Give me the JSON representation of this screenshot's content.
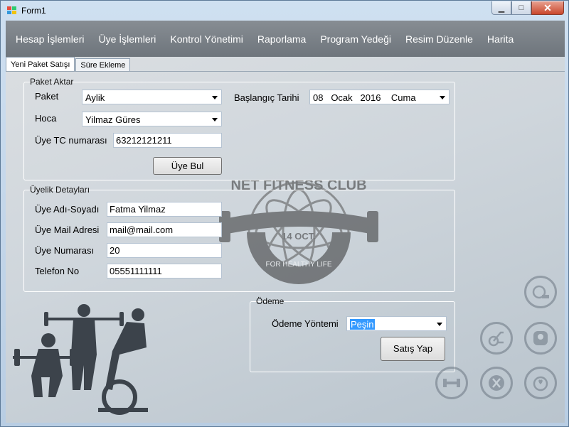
{
  "window": {
    "title": "Form1"
  },
  "menu": [
    "Hesap İşlemleri",
    "Üye İşlemleri",
    "Kontrol Yönetimi",
    "Raporlama",
    "Program Yedeği",
    "Resim Düzenle",
    "Harita"
  ],
  "tabs": [
    "Yeni Paket Satışı",
    "Süre Ekleme"
  ],
  "paket": {
    "group_label": "Paket Aktar",
    "paket_label": "Paket",
    "paket_value": "Aylik",
    "hoca_label": "Hoca",
    "hoca_value": "Yilmaz Güres",
    "tc_label": "Üye TC numarası",
    "tc_value": "63212121211",
    "start_label": "Başlangıç Tarihi",
    "date_day": "08",
    "date_month": "Ocak",
    "date_year": "2016",
    "date_weekday": "Cuma",
    "find_button": "Üye Bul"
  },
  "uyelik": {
    "group_label": "Üyelik Detayları",
    "name_label": "Üye Adı-Soyadı",
    "name_value": "Fatma Yilmaz",
    "mail_label": "Üye Mail Adresi",
    "mail_value": "mail@mail.com",
    "number_label": "Üye Numarası",
    "number_value": "20",
    "phone_label": "Telefon No",
    "phone_value": "05551111111"
  },
  "odeme": {
    "group_label": "Ödeme",
    "method_label": "Ödeme Yöntemi",
    "method_value": "Peşin",
    "sell_button": "Satış Yap"
  },
  "logo": {
    "line1": "NET FITNESS CLUB",
    "line2": "14 OCT.",
    "line3": "FOR HEALTHY LIFE"
  },
  "icons": [
    "tape-measure-icon",
    "exercise-bike-icon",
    "scale-icon",
    "dumbbell-icon",
    "nutrition-icon",
    "stopwatch-icon"
  ]
}
